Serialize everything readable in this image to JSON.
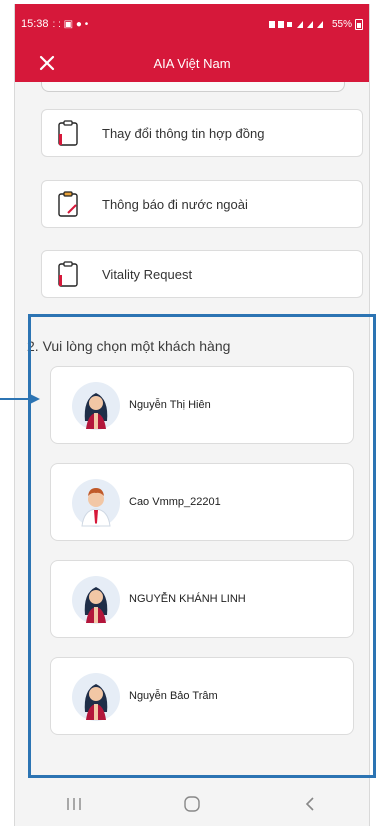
{
  "status_bar": {
    "time": "15:38",
    "left_glyphs": ": : ▣ ● •",
    "right_text": "55%"
  },
  "app_bar": {
    "title": "AIA Việt Nam",
    "close_icon": "close-icon"
  },
  "menu_items": [
    {
      "label": "Thay đổi thông tin hợp đồng",
      "icon": "clipboard-icon"
    },
    {
      "label": "Thông báo đi nước ngoài",
      "icon": "clipboard-edit-icon"
    },
    {
      "label": "Vitality Request",
      "icon": "clipboard-icon"
    }
  ],
  "section": {
    "heading": "2. Vui lòng chọn một khách hàng"
  },
  "customers": [
    {
      "name": "Nguyễn Thị Hiên",
      "avatar": "female-avatar"
    },
    {
      "name": "Cao Vmmp_22201",
      "avatar": "male-avatar"
    },
    {
      "name": "NGUYỄN KHÁNH LINH",
      "avatar": "female-avatar"
    },
    {
      "name": "Nguyễn Bảo Trâm",
      "avatar": "female-avatar"
    }
  ],
  "nav_bar": {
    "recent_glyph": "|||",
    "home_glyph": "○",
    "back_glyph": "<"
  },
  "colors": {
    "brand_red": "#d6183a",
    "highlight_blue": "#2c74b3"
  }
}
